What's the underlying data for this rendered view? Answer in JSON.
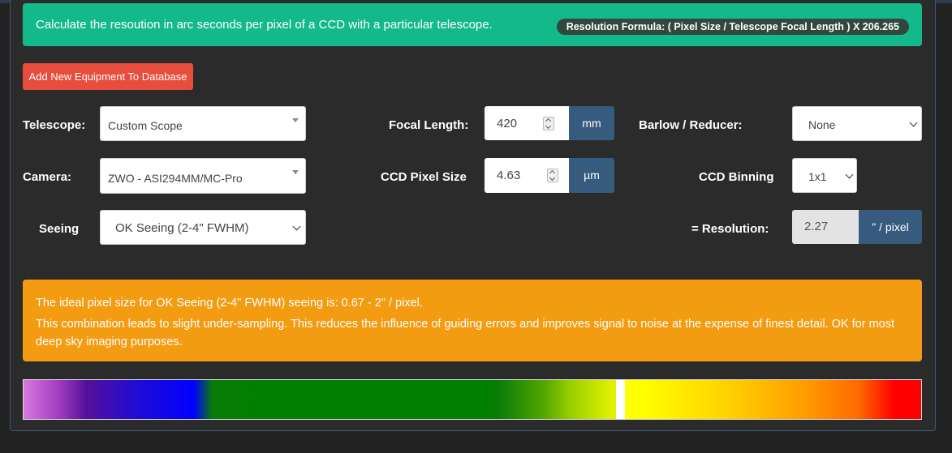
{
  "banner": {
    "description": "Calculate the resoution in arc seconds per pixel of a CCD with a particular telescope.",
    "formula": "Resolution Formula:  (   Pixel Size   /   Telescope Focal Length   )   X 206.265"
  },
  "add_button": "Add New Equipment To Database",
  "telescope": {
    "label": "Telescope:",
    "value": "Custom Scope"
  },
  "camera": {
    "label": "Camera:",
    "value": "ZWO - ASI294MM/MC-Pro"
  },
  "seeing": {
    "label": "Seeing",
    "value": "OK Seeing (2-4\" FWHM)"
  },
  "focal_length": {
    "label": "Focal Length:",
    "value": "420",
    "unit": "mm"
  },
  "pixel_size": {
    "label": "CCD Pixel Size",
    "value": "4.63",
    "unit": "µm"
  },
  "barlow": {
    "label": "Barlow / Reducer:",
    "value": "None"
  },
  "binning": {
    "label": "CCD Binning",
    "value": "1x1"
  },
  "resolution": {
    "label": "=  Resolution:",
    "value": "2.27",
    "unit": "\" / pixel"
  },
  "alert": {
    "line1": "The ideal pixel size for OK Seeing (2-4\" FWHM) seeing is: 0.67 - 2\" / pixel.",
    "line2": "This combination leads to slight under-sampling. This reduces the influence of guiding errors and improves signal to noise at the expense of finest detail. OK for most deep sky imaging purposes."
  },
  "colors": {
    "banner": "#13b98b",
    "add_button": "#e74c3c",
    "alert": "#f39c12",
    "unit_addon": "#375a7f"
  },
  "icons": {
    "select_caret": "caret-down-icon",
    "select_chevron": "chevron-down-icon",
    "spinner": "spinner-arrows-icon"
  }
}
